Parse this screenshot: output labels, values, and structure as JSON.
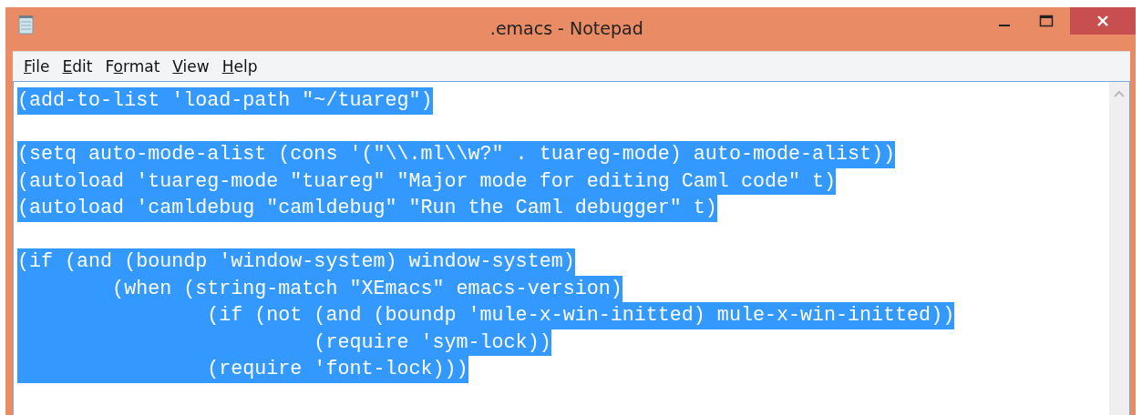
{
  "window": {
    "title": ".emacs - Notepad"
  },
  "menu": [
    {
      "parts": [
        {
          "text": "F",
          "underline": true
        },
        {
          "text": "ile",
          "underline": false
        }
      ]
    },
    {
      "parts": [
        {
          "text": "E",
          "underline": true
        },
        {
          "text": "dit",
          "underline": false
        }
      ]
    },
    {
      "parts": [
        {
          "text": "F",
          "underline": false
        },
        {
          "text": "o",
          "underline": true
        },
        {
          "text": "rmat",
          "underline": false
        }
      ]
    },
    {
      "parts": [
        {
          "text": "V",
          "underline": true
        },
        {
          "text": "iew",
          "underline": false
        }
      ]
    },
    {
      "parts": [
        {
          "text": "H",
          "underline": true
        },
        {
          "text": "elp",
          "underline": false
        }
      ]
    }
  ],
  "editor": {
    "paragraphs": [
      {
        "lines": [
          {
            "text": "(add-to-list 'load-path \"~/tuareg\")",
            "selected": true
          }
        ]
      },
      {
        "lines": [
          {
            "text": "(setq auto-mode-alist (cons '(\"\\\\.ml\\\\w?\" . tuareg-mode) auto-mode-alist))",
            "selected": true
          },
          {
            "text": "(autoload 'tuareg-mode \"tuareg\" \"Major mode for editing Caml code\" t)",
            "selected": true
          },
          {
            "text": "(autoload 'camldebug \"camldebug\" \"Run the Caml debugger\" t)",
            "selected": true
          }
        ]
      },
      {
        "lines": [
          {
            "text": "(if (and (boundp 'window-system) window-system)",
            "selected": true
          },
          {
            "text": "        (when (string-match \"XEmacs\" emacs-version)",
            "selected": true
          },
          {
            "text": "                (if (not (and (boundp 'mule-x-win-initted) mule-x-win-initted))",
            "selected": true
          },
          {
            "text": "                         (require 'sym-lock))",
            "selected": true
          },
          {
            "text": "                (require 'font-lock)))",
            "selected": true
          }
        ]
      }
    ]
  }
}
